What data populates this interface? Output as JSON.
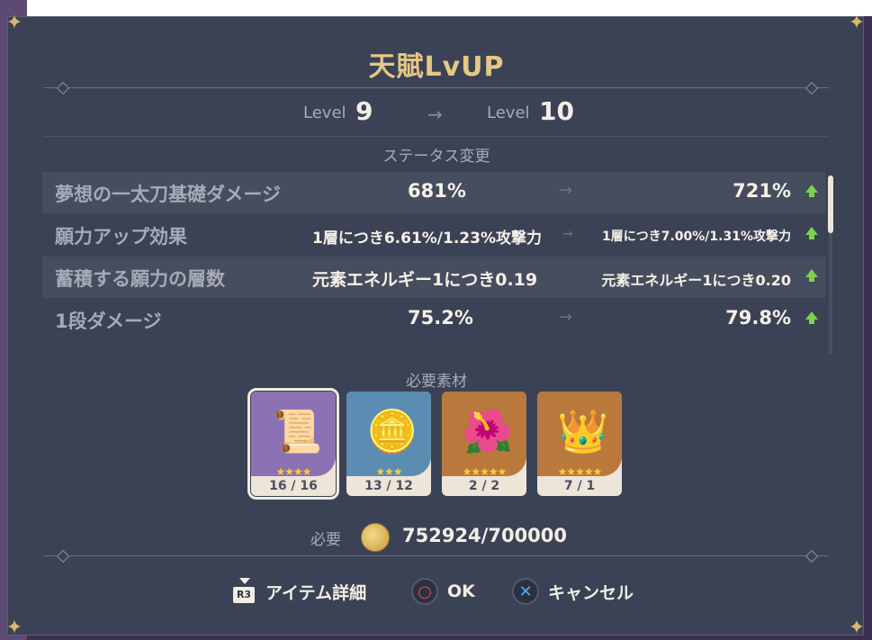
{
  "title": "天賦LvUP",
  "levels": {
    "from_label": "Level",
    "from_value": "9",
    "to_label": "Level",
    "to_value": "10",
    "arrow": "→"
  },
  "stats_header": "ステータス変更",
  "stats": [
    {
      "name": "夢想の一太刀基礎ダメージ",
      "current": "681%",
      "arrow": "→",
      "next": "721%"
    },
    {
      "name": "願力アップ効果",
      "current": "1層につき6.61%/1.23%攻撃力",
      "arrow": "→",
      "next": "1層につき7.00%/1.31%攻撃力"
    },
    {
      "name": "蓄積する願力の層数",
      "current": "元素エネルギー1につき0.19",
      "arrow": "→",
      "next": "元素エネルギー1につき0.20"
    },
    {
      "name": "1段ダメージ",
      "current": "75.2%",
      "arrow": "→",
      "next": "79.8%"
    }
  ],
  "materials_header": "必要素材",
  "materials": [
    {
      "icon": "scroll-icon",
      "glyph": "📜",
      "stars": "★★★★",
      "count": "16 / 16",
      "bg": "#8c72b3"
    },
    {
      "icon": "tsuba-icon",
      "glyph": "🪙",
      "stars": "★★★",
      "count": "13 / 12",
      "bg": "#5b8db3"
    },
    {
      "icon": "flower-icon",
      "glyph": "🌺",
      "stars": "★★★★★",
      "count": "2 / 2",
      "bg": "#b9793d"
    },
    {
      "icon": "crown-icon",
      "glyph": "👑",
      "stars": "★★★★★",
      "count": "7 / 1",
      "bg": "#b9793d"
    }
  ],
  "cost": {
    "label": "必要",
    "value": "752924/700000"
  },
  "actions": {
    "details_label": "アイテム詳細",
    "details_key": "R3",
    "ok_label": "OK",
    "ok_glyph": "○",
    "cancel_label": "キャンセル",
    "cancel_glyph": "✕"
  },
  "colors": {
    "accent": "#e6c785",
    "up": "#7cd34a",
    "ok": "#e84a55",
    "cancel": "#4ab0e8"
  }
}
